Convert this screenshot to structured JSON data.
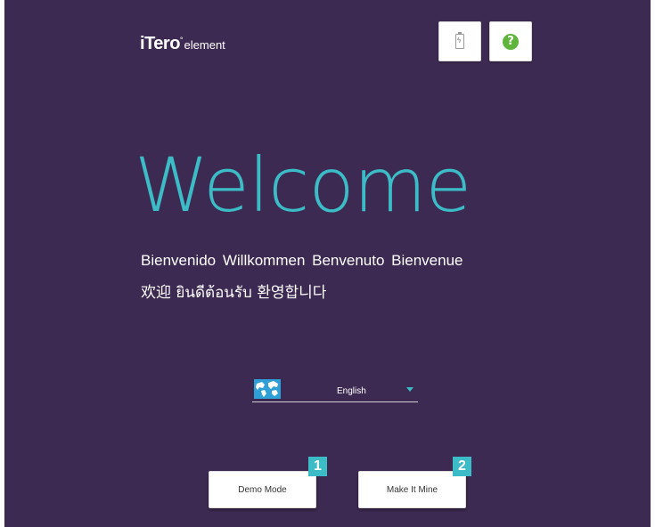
{
  "header": {
    "logo_brand": "Tero",
    "logo_mark": "i",
    "logo_sub": "element",
    "battery_icon": "battery-icon",
    "help_icon": "help-icon",
    "help_glyph": "?"
  },
  "welcome": {
    "title": "Welcome",
    "greetings_line1": "Bienvenido  Willkommen  Benvenuto  Bienvenue",
    "greetings_line2": "欢迎  ยินดีต้อนรับ  환영합니다"
  },
  "language": {
    "icon": "globe-icon",
    "selected": "English"
  },
  "buttons": {
    "demo_label": "Demo Mode",
    "mine_label": "Make It Mine"
  },
  "callouts": {
    "one": "1",
    "two": "2"
  },
  "colors": {
    "background": "#3d2a52",
    "accent": "#3bbcc6",
    "help_green": "#5fb53c"
  }
}
